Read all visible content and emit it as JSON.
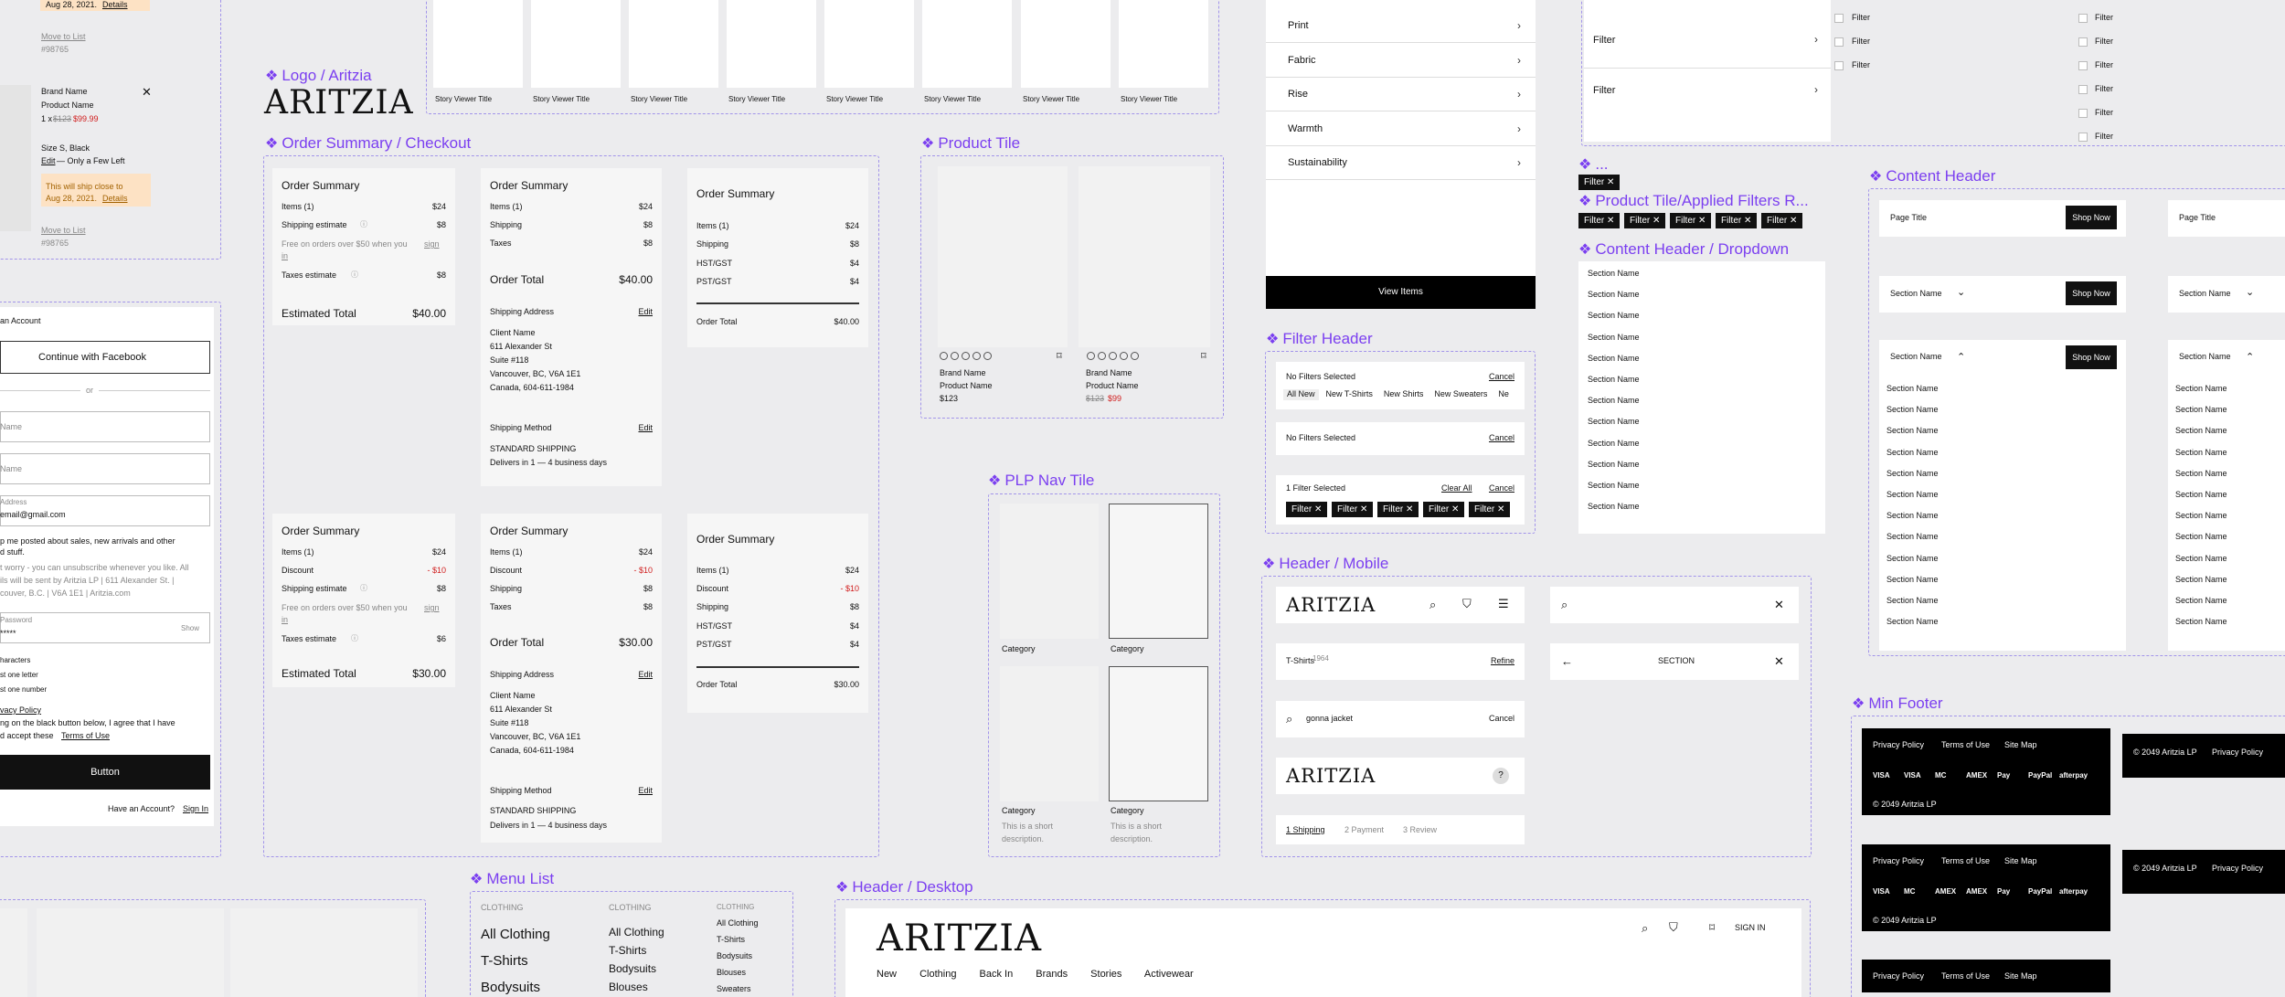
{
  "labels": {
    "logo": "Logo / Aritzia",
    "order": "Order Summary / Checkout",
    "product_tile": "Product Tile",
    "plp": "PLP Nav Tile",
    "menu": "Menu List",
    "header_desktop": "Header / Desktop",
    "filter_header": "Filter Header",
    "header_mobile": "Header / Mobile",
    "ellipsis": "...",
    "applied": "Product Tile/Applied Filters R...",
    "content_dropdown": "Content Header / Dropdown",
    "content_header": "Content Header",
    "min_footer": "Min Footer"
  },
  "brand": {
    "name": "ARITZIA"
  },
  "cart": {
    "date1": "Aug 28, 2021.",
    "details": "Details",
    "move": "Move to List",
    "sku": "#98765",
    "brand": "Brand Name",
    "product": "Product Name",
    "qty": "1 x",
    "old_price": "$123",
    "new_price": "$99.99",
    "size": "Size S, Black",
    "edit": "Edit",
    "few_left": "— Only a Few Left",
    "ship_note": "This will ship close to",
    "date2": "Aug 28, 2021.",
    "move2": "Move to List",
    "sku2": "#98765"
  },
  "account": {
    "title": "an Account",
    "facebook": "Continue with Facebook",
    "or": "or",
    "name1": "Name",
    "name2": "Name",
    "email_lbl": "Address",
    "email": "email@gmail.com",
    "opt1": "p me posted about sales, new arrivals and other",
    "opt2": "d stuff.",
    "fine1": "t worry - you can unsubscribe whenever you like. All",
    "fine2": "ils will be sent by Aritzia LP | 611 Alexander St. |",
    "fine3": "couver, B.C. | V6A 1E1 | Aritzia.com",
    "pw_lbl": "Password",
    "pw": "*****",
    "show": "Show",
    "rule1": "haracters",
    "rule2": "st one letter",
    "rule3": "st one number",
    "privacy": "vacy Policy",
    "agree1": "ng on the black button below, I agree that I have",
    "agree2": "d accept these",
    "terms": "Terms of Use",
    "button": "Button",
    "have": "Have an Account?",
    "signin": "Sign In"
  },
  "stories": {
    "title": "Story Viewer Title"
  },
  "os": {
    "title": "Order Summary",
    "items": "Items (1)",
    "discount": "Discount",
    "shipping_est": "Shipping estimate",
    "shipping": "Shipping",
    "taxes": "Taxes",
    "taxes_est": "Taxes estimate",
    "free1": "Free on orders over $50 when you",
    "sign": "sign",
    "in": "in",
    "hst": "HST/GST",
    "pst": "PST/GST",
    "order_total": "Order Total",
    "est_total": "Estimated Total",
    "v24": "$24",
    "v8": "$8",
    "v6": "$6",
    "v4": "$4",
    "d10": "- $10",
    "t40": "$40.00",
    "t30": "$30.00",
    "ship_addr": "Shipping Address",
    "edit": "Edit",
    "client": "Client Name",
    "street": "611 Alexander St",
    "suite": "Suite #118",
    "city": "Vancouver, BC, V6A 1E1",
    "country": "Canada, 604-611-1984",
    "ship_method": "Shipping Method",
    "standard": "STANDARD SHIPPING",
    "delivers": "Delivers in 1 — 4 business days"
  },
  "tile": {
    "brand": "Brand Name",
    "product": "Product Name",
    "price": "$123",
    "old": "$123",
    "sale": "$99"
  },
  "plp": {
    "cat": "Category",
    "desc1": "This is a short",
    "desc2": "description."
  },
  "menu": {
    "head": "CLOTHING",
    "all": "All Clothing",
    "tshirts": "T-Shirts",
    "bodysuits": "Bodysuits",
    "blouses": "Blouses",
    "sweaters": "Sweaters"
  },
  "desktop": {
    "nav": [
      "New",
      "Clothing",
      "Back In",
      "Brands",
      "Stories",
      "Activewear"
    ],
    "signin": "SIGN IN"
  },
  "filterlist": {
    "items": [
      "Print",
      "Fabric",
      "Rise",
      "Warmth",
      "Sustainability"
    ],
    "view": "View Items"
  },
  "fh": {
    "none": "No Filters Selected",
    "cancel": "Cancel",
    "tabs": [
      "All New",
      "New T-Shirts",
      "New Shirts",
      "New Sweaters",
      "Ne"
    ],
    "one": "1 Filter Selected",
    "clear": "Clear All",
    "filter": "Filter"
  },
  "mobile": {
    "tshirts": "T-Shirts",
    "count": "1964",
    "refine": "Refine",
    "query": "gonna jacket",
    "cancel": "Cancel",
    "section": "SECTION",
    "steps": [
      "1 Shipping",
      "2 Payment",
      "3 Review"
    ]
  },
  "filters_panel": {
    "filter": "Filter"
  },
  "dropdown": {
    "section": "Section Name"
  },
  "content": {
    "page_title": "Page Title",
    "shop": "Shop Now",
    "section": "Section Name"
  },
  "footer": {
    "privacy": "Privacy Policy",
    "terms": "Terms of Use",
    "sitemap": "Site Map",
    "copy": "© 2049 Aritzia LP",
    "pay": [
      "VISA",
      "VISA",
      "MC",
      "AMEX",
      "Pay",
      "PayPal",
      "afterpay"
    ]
  }
}
